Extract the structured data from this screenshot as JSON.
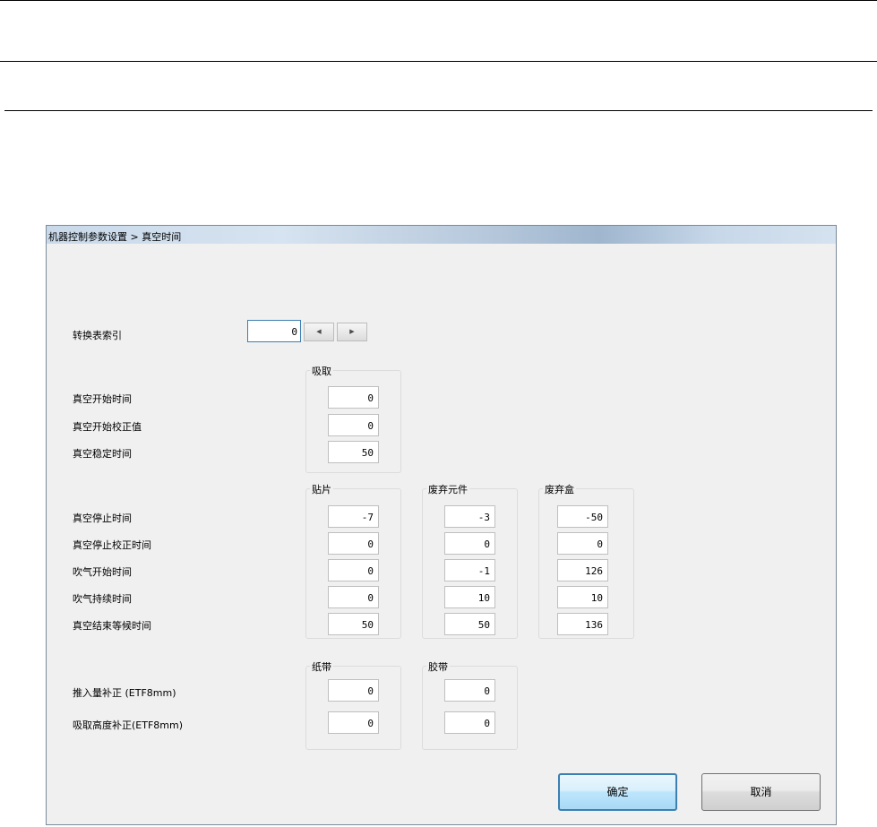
{
  "dialog": {
    "title": "机器控制参数设置 > 真空时间",
    "index_label": "转换表索引",
    "index_value": "0",
    "spin_left": "◀",
    "spin_right": "▶",
    "pickup": {
      "group_title": "吸取",
      "rows": [
        {
          "label": "真空开始时间",
          "value": "0"
        },
        {
          "label": "真空开始校正值",
          "value": "0"
        },
        {
          "label": "真空稳定时间",
          "value": "50"
        }
      ]
    },
    "stop": {
      "group_titles": [
        "贴片",
        "废弃元件",
        "废弃盒"
      ],
      "labels": [
        "真空停止时间",
        "真空停止校正时间",
        "吹气开始时间",
        "吹气持续时间",
        "真空结束等候时间"
      ],
      "mount": [
        "-7",
        "0",
        "0",
        "0",
        "50"
      ],
      "discard_part": [
        "-3",
        "0",
        "-1",
        "10",
        "50"
      ],
      "discard_box": [
        "-50",
        "0",
        "126",
        "10",
        "136"
      ]
    },
    "tape": {
      "group_titles": [
        "纸带",
        "胶带"
      ],
      "labels": [
        "推入量补正 (ETF8mm)",
        "吸取高度补正(ETF8mm)"
      ],
      "paper": [
        "0",
        "0"
      ],
      "plastic": [
        "0",
        "0"
      ]
    },
    "ok_label": "确定",
    "cancel_label": "取消"
  }
}
